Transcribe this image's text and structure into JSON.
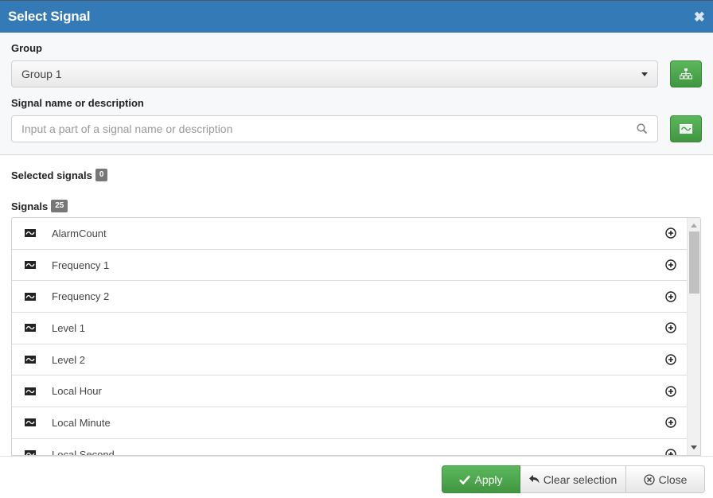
{
  "dialog": {
    "title": "Select Signal",
    "close_icon": "close-icon"
  },
  "filter": {
    "group_label": "Group",
    "group_value": "Group 1",
    "group_button_icon": "sitemap-icon",
    "search_label": "Signal name or description",
    "search_value": "",
    "search_placeholder": "Input a part of a signal name or description",
    "search_icon": "search-icon",
    "signal_button_icon": "signal-wave-icon"
  },
  "selected": {
    "label": "Selected signals",
    "count": "0"
  },
  "signals": {
    "label": "Signals",
    "count": "25",
    "items": [
      {
        "name": "AlarmCount",
        "icon": "signal-wave-icon",
        "action_icon": "plus-circle-icon"
      },
      {
        "name": "Frequency 1",
        "icon": "signal-wave-icon",
        "action_icon": "plus-circle-icon"
      },
      {
        "name": "Frequency 2",
        "icon": "signal-wave-icon",
        "action_icon": "plus-circle-icon"
      },
      {
        "name": "Level 1",
        "icon": "signal-wave-icon",
        "action_icon": "plus-circle-icon"
      },
      {
        "name": "Level 2",
        "icon": "signal-wave-icon",
        "action_icon": "plus-circle-icon"
      },
      {
        "name": "Local Hour",
        "icon": "signal-wave-icon",
        "action_icon": "plus-circle-icon"
      },
      {
        "name": "Local Minute",
        "icon": "signal-wave-icon",
        "action_icon": "plus-circle-icon"
      },
      {
        "name": "Local Second",
        "icon": "signal-wave-icon",
        "action_icon": "plus-circle-icon"
      }
    ]
  },
  "footer": {
    "apply_label": "Apply",
    "apply_icon": "check-icon",
    "clear_label": "Clear selection",
    "clear_icon": "reply-icon",
    "close_label": "Close",
    "close_icon": "times-circle-icon"
  },
  "colors": {
    "header": "#337ab7",
    "success": "#5cb85c",
    "badge": "#777777"
  }
}
